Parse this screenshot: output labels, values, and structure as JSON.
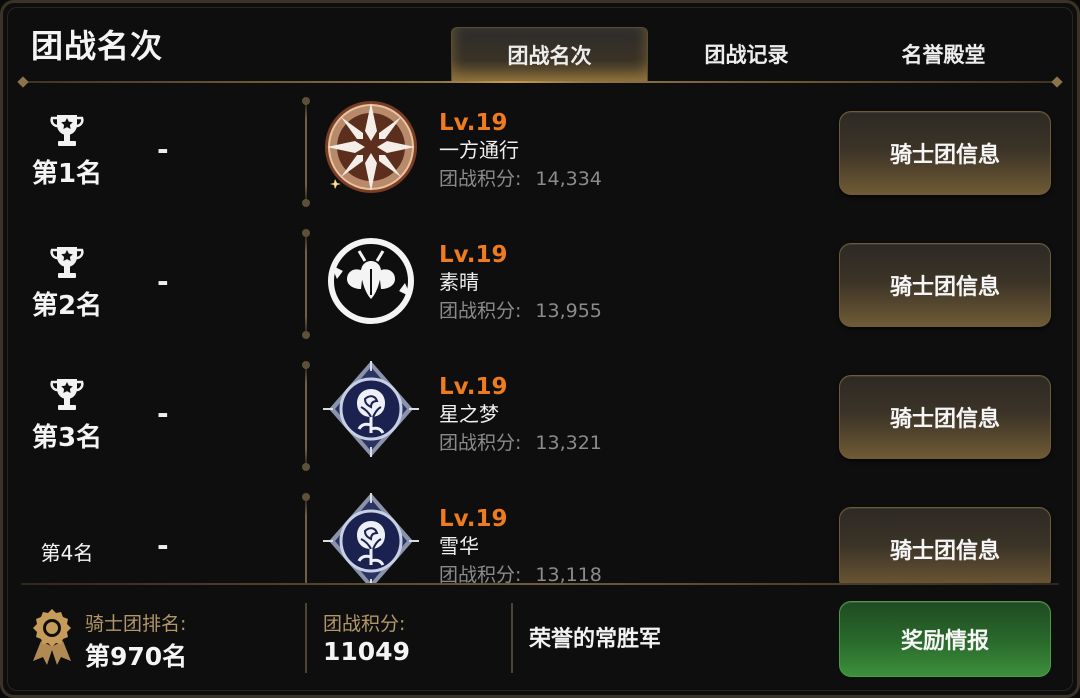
{
  "header": {
    "title": "团战名次",
    "tabs": [
      {
        "label": "团战名次",
        "active": true
      },
      {
        "label": "团战记录",
        "active": false
      },
      {
        "label": "名誉殿堂",
        "active": false
      }
    ]
  },
  "rankings": [
    {
      "rank_label": "第1名",
      "trophy": true,
      "dash": "-",
      "emblem": "compass-star-emblem-icon",
      "level": "Lv.19",
      "name": "一方通行",
      "score_label": "团战积分:",
      "score": "14,334",
      "button_label": "骑士团信息"
    },
    {
      "rank_label": "第2名",
      "trophy": true,
      "dash": "-",
      "emblem": "insect-circle-emblem-icon",
      "level": "Lv.19",
      "name": "素晴",
      "score_label": "团战积分:",
      "score": "13,955",
      "button_label": "骑士团信息"
    },
    {
      "rank_label": "第3名",
      "trophy": true,
      "dash": "-",
      "emblem": "rose-emblem-icon",
      "level": "Lv.19",
      "name": "星之梦",
      "score_label": "团战积分:",
      "score": "13,321",
      "button_label": "骑士团信息"
    },
    {
      "rank_label": "第4名",
      "trophy": false,
      "dash": "-",
      "emblem": "rose-emblem-icon",
      "level": "Lv.19",
      "name": "雪华",
      "score_label": "团战积分:",
      "score": "13,118",
      "button_label": "骑士团信息"
    }
  ],
  "footer": {
    "guild_rank_label": "骑士团排名:",
    "guild_rank_value": "第970名",
    "score_label": "团战积分:",
    "score_value": "11049",
    "honor_title": "荣誉的常胜军",
    "reward_button_label": "奖励情报"
  },
  "colors": {
    "level": "#ee7c1e",
    "gold_accent": "#b19769",
    "reward_green": "#2a6b2c"
  }
}
